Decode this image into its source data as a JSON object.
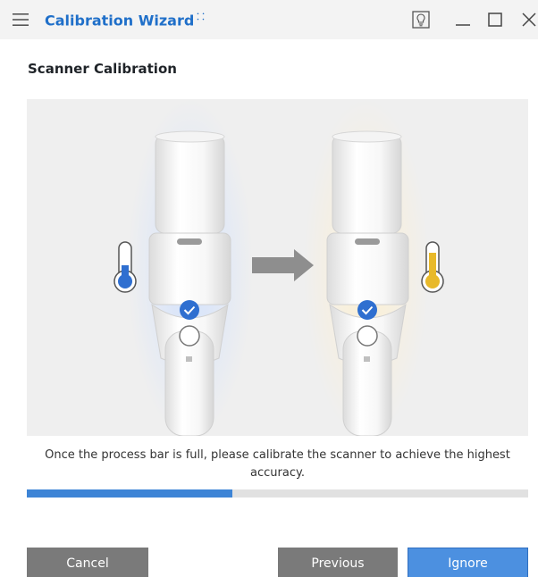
{
  "window": {
    "title": "Calibration Wizard",
    "title_mark": "⸬"
  },
  "page": {
    "heading": "Scanner Calibration"
  },
  "illustration": {
    "icons": [
      "thermometer-cold-icon",
      "arrow-right-icon",
      "thermometer-warm-icon",
      "scanner-icon"
    ],
    "cold_color": "#2f6fd0",
    "warm_color": "#e8b92a"
  },
  "instruction": {
    "text": "Once the process bar is full, please calibrate the scanner to achieve the highest accuracy."
  },
  "progress": {
    "percent": 41,
    "color": "#3d84d6"
  },
  "buttons": {
    "cancel": "Cancel",
    "previous": "Previous",
    "ignore": "Ignore"
  },
  "colors": {
    "accent": "#1f6fc9",
    "button_gray": "#7a7a7a",
    "button_primary": "#4c90e0"
  }
}
